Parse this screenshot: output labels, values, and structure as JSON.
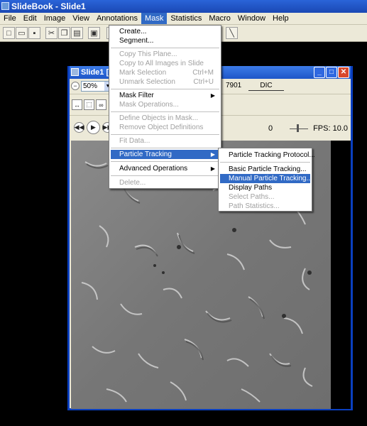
{
  "app": {
    "title": "SlideBook - Slide1"
  },
  "menubar": {
    "items": [
      "File",
      "Edit",
      "Image",
      "View",
      "Annotations",
      "Mask",
      "Statistics",
      "Macro",
      "Window",
      "Help"
    ],
    "active": "Mask"
  },
  "document": {
    "title": "Slide1 [2",
    "zoom": "50%",
    "channel_frag": "7901",
    "channel_label": "DIC",
    "frame_value": "0",
    "fps_text": "FPS: 10.0"
  },
  "mask_menu": {
    "items": [
      {
        "label": "Create...",
        "enabled": true
      },
      {
        "label": "Segment...",
        "enabled": true
      },
      {
        "label": "Copy This Plane...",
        "enabled": false
      },
      {
        "label": "Copy to All Images in Slide",
        "enabled": false
      },
      {
        "label": "Mark Selection",
        "shortcut": "Ctrl+M",
        "enabled": false
      },
      {
        "label": "Unmark Selection",
        "shortcut": "Ctrl+U",
        "enabled": false
      },
      {
        "label": "Mask Filter",
        "submenu": true,
        "enabled": true
      },
      {
        "label": "Mask Operations...",
        "enabled": false
      },
      {
        "label": "Define Objects in Mask...",
        "enabled": false
      },
      {
        "label": "Remove Object Definitions",
        "enabled": false
      },
      {
        "label": "Fit Data...",
        "enabled": false
      },
      {
        "label": "Particle Tracking",
        "submenu": true,
        "enabled": true,
        "highlighted": true
      },
      {
        "label": "Advanced Operations",
        "submenu": true,
        "enabled": true
      },
      {
        "label": "Delete...",
        "enabled": false
      }
    ]
  },
  "particle_submenu": {
    "items": [
      {
        "label": "Particle Tracking Protocol...",
        "enabled": true
      },
      {
        "label": "Basic Particle Tracking...",
        "enabled": true
      },
      {
        "label": "Manual Particle Tracking...",
        "enabled": true,
        "highlighted": true
      },
      {
        "label": "Display Paths",
        "enabled": true
      },
      {
        "label": "Select Paths...",
        "enabled": false
      },
      {
        "label": "Path Statistics...",
        "enabled": false
      }
    ]
  },
  "icons": [
    "new-icon",
    "open-icon",
    "save-icon",
    "cut-icon",
    "copy-icon",
    "paste-icon",
    "print-icon",
    "mask-tool-icon",
    "line-tool-icon",
    "play-icon",
    "rewind-icon",
    "forward-icon"
  ]
}
